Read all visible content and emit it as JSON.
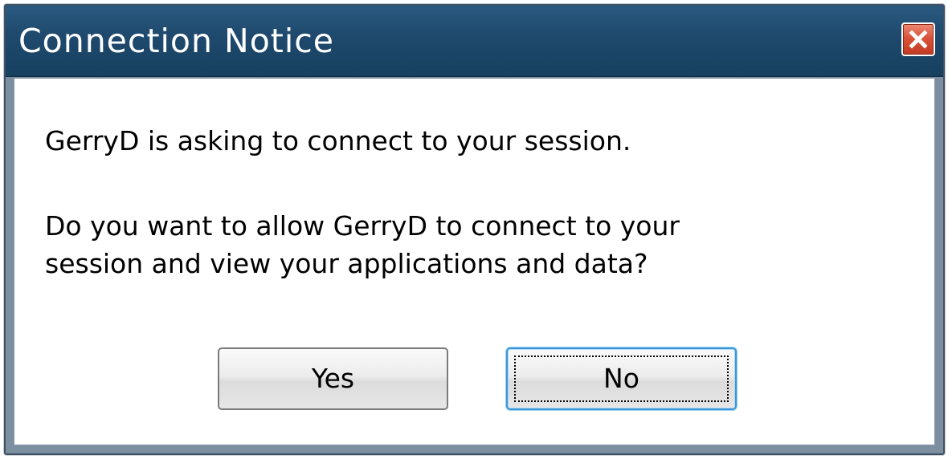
{
  "window": {
    "title": "Connection Notice",
    "close_icon": "close-icon"
  },
  "message": {
    "line1": "GerryD is asking to connect to your session.",
    "line2a": "Do you want to allow GerryD to connect to your",
    "line2b": "session and view your applications and data?"
  },
  "buttons": {
    "yes_label": "Yes",
    "no_label": "No",
    "focused": "No"
  },
  "colors": {
    "titlebar": "#1f4a6e",
    "close_button": "#d9533a",
    "focus_border": "#3c96d6"
  }
}
